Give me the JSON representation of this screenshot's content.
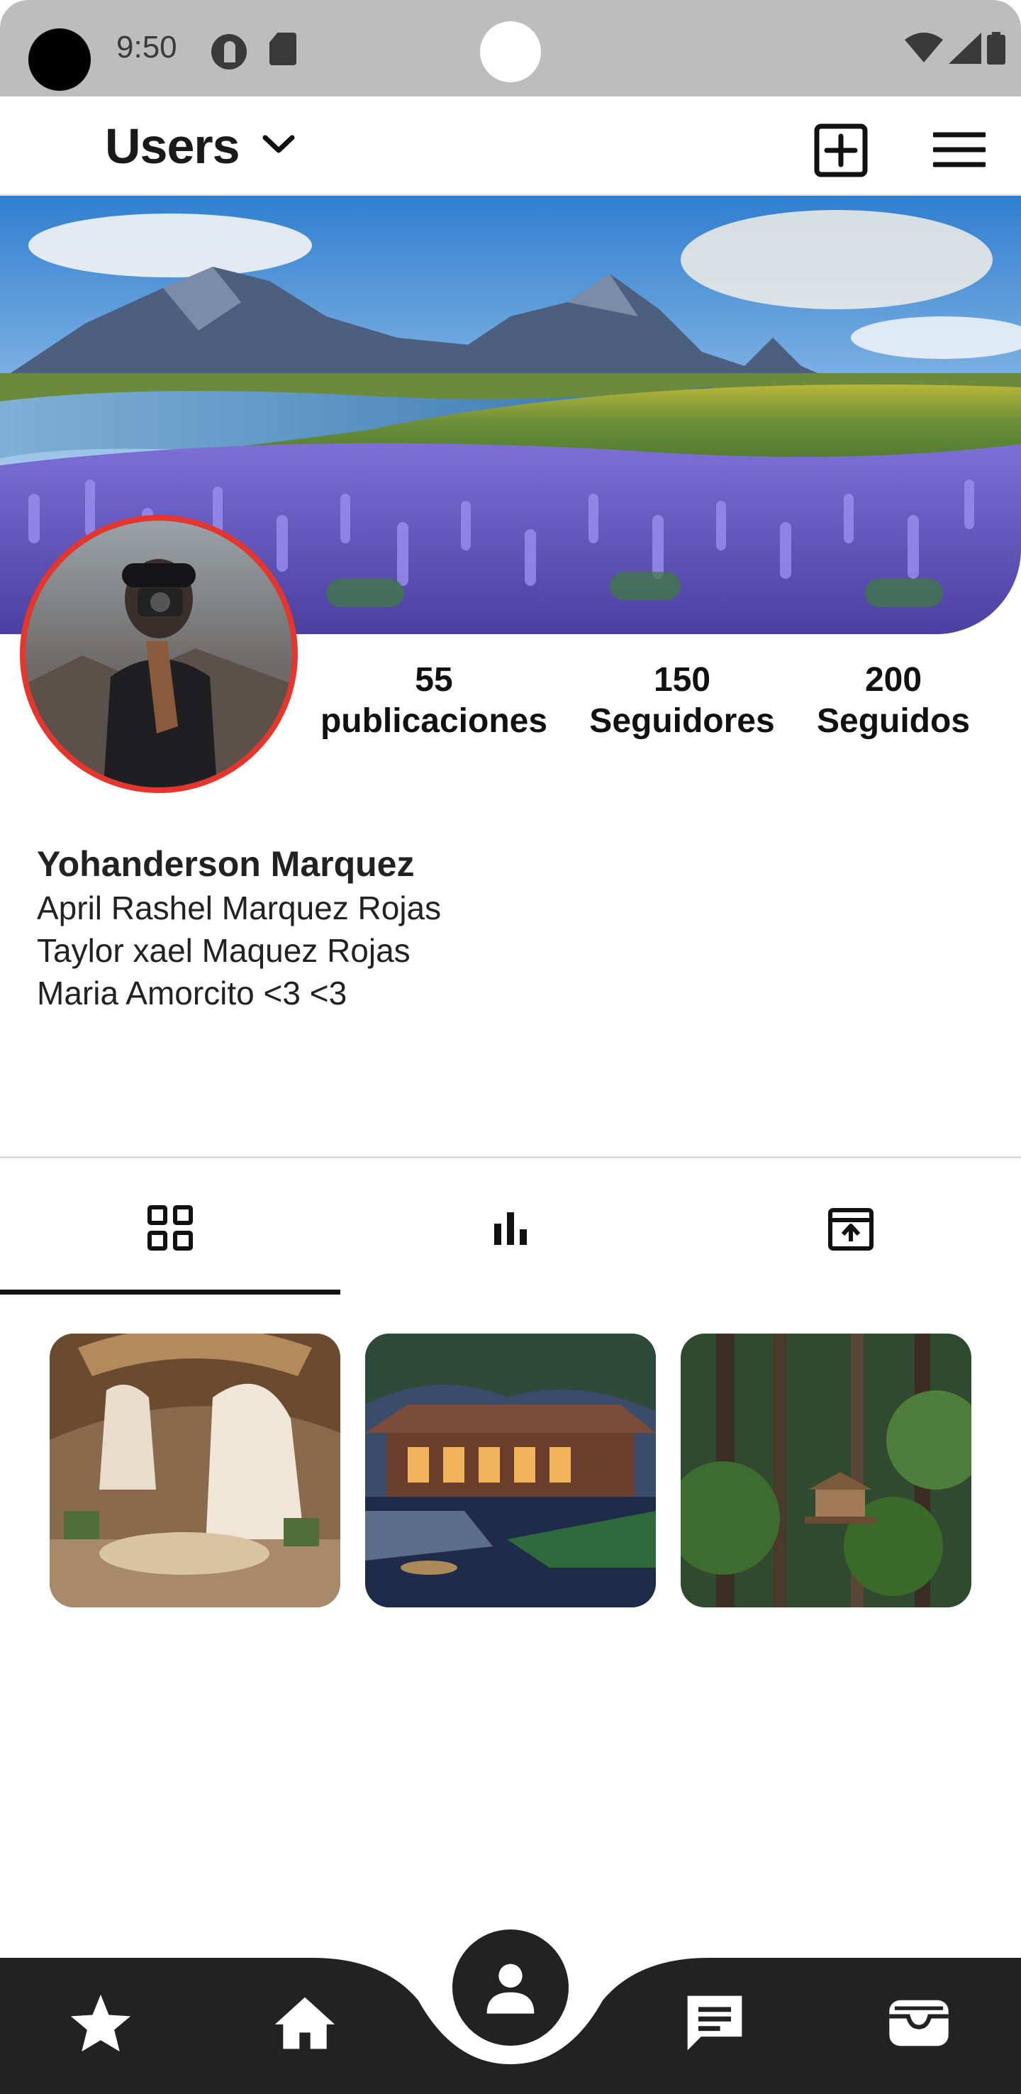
{
  "status_bar": {
    "time": "9:50",
    "icons": [
      "camera-cutout",
      "privacy-icon",
      "sim-card-icon",
      "wifi-icon",
      "signal-icon",
      "battery-icon"
    ]
  },
  "header": {
    "title": "Users",
    "icons": [
      "chevron-down-icon",
      "add-box-icon",
      "menu-icon"
    ]
  },
  "profile": {
    "cover": "cover-image",
    "avatar": "avatar-image",
    "stats": [
      {
        "value": "55",
        "label": "publicaciones"
      },
      {
        "value": "150",
        "label": "Seguidores"
      },
      {
        "value": "200",
        "label": "Seguidos"
      }
    ],
    "name": "Yohanderson Marquez",
    "bio_lines": [
      "April Rashel Marquez Rojas",
      "Taylor xael Maquez Rojas",
      "Maria Amorcito <3 <3"
    ]
  },
  "tabs": [
    {
      "icon": "grid-icon",
      "active": true
    },
    {
      "icon": "bar-chart-icon",
      "active": false
    },
    {
      "icon": "archive-upload-icon",
      "active": false
    }
  ],
  "posts": [
    "post-thumbnail-1",
    "post-thumbnail-2",
    "post-thumbnail-3"
  ],
  "bottom_nav": [
    {
      "icon": "star-icon",
      "active": false
    },
    {
      "icon": "home-icon",
      "active": false
    },
    {
      "icon": "profile-icon",
      "active": true
    },
    {
      "icon": "chat-icon",
      "active": false
    },
    {
      "icon": "wallet-icon",
      "active": false
    }
  ],
  "colors": {
    "status_bar": "#bdbdbd",
    "avatar_ring": "#e5352c",
    "bottom_nav": "#222222",
    "accent": "#111111"
  }
}
